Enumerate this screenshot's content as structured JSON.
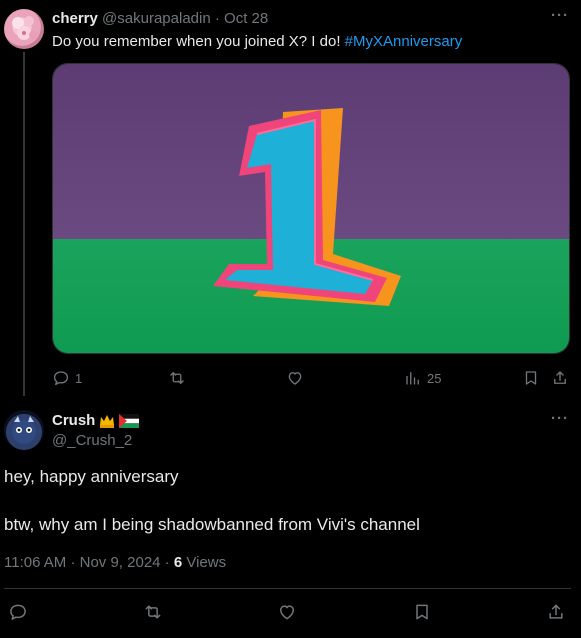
{
  "tweet1": {
    "display_name": "cherry",
    "handle": "@sakurapaladin",
    "separator": "·",
    "date": "Oct 28",
    "text": "Do you remember when you joined X? I do! ",
    "hashtag": "#MyXAnniversary",
    "more_glyph": "···",
    "media_icon": "number-one-anniversary-image",
    "actions": {
      "reply_count": "1",
      "retweet_count": "",
      "like_count": "",
      "views_count": "25"
    }
  },
  "tweet2": {
    "display_name": "Crush",
    "handle": "@_Crush_2",
    "more_glyph": "···",
    "emoji": [
      "crown-emoji",
      "palestine-flag-emoji"
    ],
    "line1": "hey, happy anniversary",
    "line2": "btw, why am I being shadowbanned from Vivi's channel",
    "time": "11:06 AM",
    "dot": "·",
    "date": "Nov 9, 2024",
    "meta_sep": "·",
    "views": "6",
    "views_label": "Views"
  },
  "colors": {
    "background": "#000000",
    "text": "#e7e9ea",
    "muted": "#71767b",
    "link": "#1d9bf0",
    "border": "#2f3336"
  }
}
